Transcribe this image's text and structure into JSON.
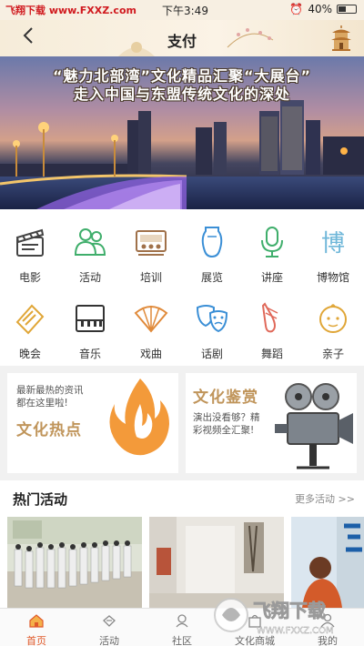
{
  "status_bar": {
    "carrier": "飞翔下载 www.FXXZ.com",
    "time": "下午3:49",
    "battery": "40%"
  },
  "header": {
    "title": "支付",
    "back_icon": "chevron-left-icon",
    "right_icon": "pagoda-icon"
  },
  "banner": {
    "caption_line1": "“魅力北部湾”文化精品汇聚“大展台”",
    "caption_line2": "走入中国与东盟传统文化的深处"
  },
  "categories": [
    {
      "label": "电影",
      "icon": "film-clapper-icon"
    },
    {
      "label": "活动",
      "icon": "people-icon"
    },
    {
      "label": "培训",
      "icon": "classroom-icon"
    },
    {
      "label": "展览",
      "icon": "vase-icon"
    },
    {
      "label": "讲座",
      "icon": "microphone-icon"
    },
    {
      "label": "博物馆",
      "icon": "museum-glyph-icon"
    },
    {
      "label": "晚会",
      "icon": "ticket-icon"
    },
    {
      "label": "音乐",
      "icon": "piano-icon"
    },
    {
      "label": "戏曲",
      "icon": "fan-icon"
    },
    {
      "label": "话剧",
      "icon": "drama-masks-icon"
    },
    {
      "label": "舞蹈",
      "icon": "ballet-shoe-icon"
    },
    {
      "label": "亲子",
      "icon": "baby-face-icon"
    }
  ],
  "promos": {
    "hot": {
      "desc_line1": "最新最热的资讯",
      "desc_line2": "都在这里啦!",
      "title": "文化热点"
    },
    "appreciation": {
      "title": "文化鉴赏",
      "desc_line1": "演出没看够？精",
      "desc_line2": "彩视频全汇聚!"
    }
  },
  "hot_activities": {
    "title": "热门活动",
    "more": "更多活动 >>"
  },
  "tabbar": [
    {
      "label": "首页",
      "icon": "home-icon",
      "active": true
    },
    {
      "label": "活动",
      "icon": "activity-icon",
      "active": false
    },
    {
      "label": "社区",
      "icon": "community-icon",
      "active": false
    },
    {
      "label": "文化商城",
      "icon": "shop-icon",
      "active": false
    },
    {
      "label": "我的",
      "icon": "profile-icon",
      "active": false
    }
  ],
  "watermark": {
    "brand": "飞翔下载",
    "url": "WWW.FXXZ.COM"
  },
  "colors": {
    "accent_gold": "#c0955b",
    "active_tab": "#e0592a",
    "icon_green": "#3fae6b",
    "icon_blue": "#3b8fd6",
    "icon_orange": "#e08a3a"
  }
}
